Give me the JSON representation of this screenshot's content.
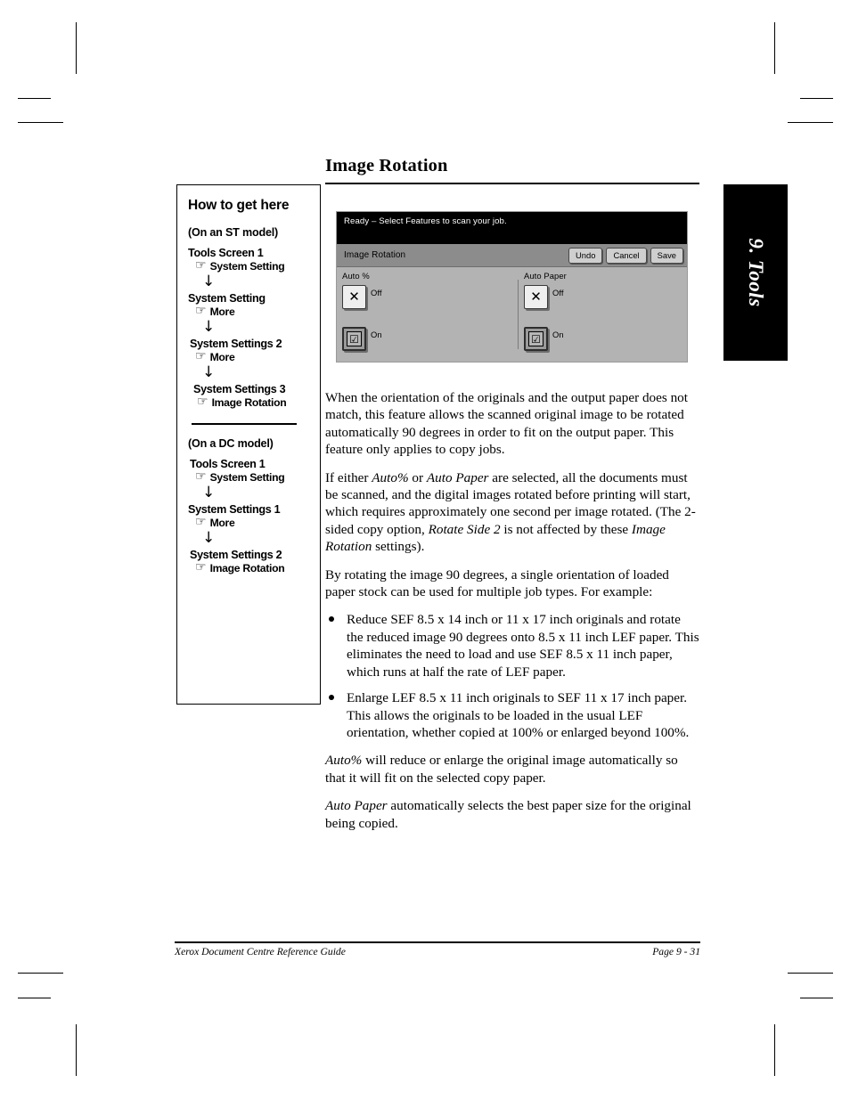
{
  "page": {
    "section_title": "Image Rotation",
    "thumb_tab_label": "9. Tools"
  },
  "howto": {
    "title": "How to get here",
    "st": {
      "model_label": "(On an ST model)",
      "steps": [
        {
          "screen": "Tools Screen 1",
          "action": "System Setting"
        },
        {
          "screen": "System Setting",
          "action": "More"
        },
        {
          "screen": "System Settings 2",
          "action": "More"
        },
        {
          "screen": "System Settings 3",
          "action": "Image Rotation"
        }
      ]
    },
    "dc": {
      "model_label": "(On a DC model)",
      "steps": [
        {
          "screen": "Tools Screen 1",
          "action": "System Setting"
        },
        {
          "screen": "System Settings 1",
          "action": "More"
        },
        {
          "screen": "System Settings 2",
          "action": "Image Rotation"
        }
      ]
    },
    "hand_icon": "☞",
    "arrow_icon": "↓"
  },
  "touchscreen": {
    "status_text": "Ready –  Select Features to scan your job.",
    "panel_title": "Image Rotation",
    "buttons": [
      {
        "label": "Undo"
      },
      {
        "label": "Cancel"
      },
      {
        "label": "Save"
      }
    ],
    "groups": [
      {
        "label": "Auto %",
        "options": [
          {
            "label": "Off",
            "glyph": "✕",
            "selected": false
          },
          {
            "label": "On",
            "glyph": "☑",
            "selected": true
          }
        ]
      },
      {
        "label": "Auto Paper",
        "options": [
          {
            "label": "Off",
            "glyph": "✕",
            "selected": false
          },
          {
            "label": "On",
            "glyph": "☑",
            "selected": true
          }
        ]
      }
    ]
  },
  "body": {
    "p1": "When the orientation of the originals and the output paper does not match, this feature allows the scanned original image to be rotated automatically 90 degrees in order to fit on the output paper. This feature only applies to copy jobs.",
    "p2_a": "If either ",
    "p2_em1": "Auto%",
    "p2_b": " or ",
    "p2_em2": "Auto Paper",
    "p2_c": " are selected, all the documents must be scanned, and the digital images rotated before printing will start, which requires approximately one second per image rotated. (The 2-sided copy option, ",
    "p2_em3": "Rotate Side 2",
    "p2_d": " is not affected by these ",
    "p2_em4": "Image Rotation",
    "p2_e": " settings).",
    "p3": "By rotating the image 90 degrees, a single orientation of loaded paper stock can be used for multiple job types. For example:",
    "bullets": [
      "Reduce SEF 8.5 x 14 inch or 11 x 17 inch originals and rotate the reduced image 90 degrees onto 8.5 x 11 inch LEF paper. This eliminates the need to load and use SEF 8.5 x 11 inch paper, which runs at half the rate of LEF paper.",
      "Enlarge LEF 8.5 x 11 inch originals to SEF 11 x 17 inch paper. This allows the originals to be loaded in the usual LEF orientation, whether copied at 100% or enlarged beyond 100%."
    ],
    "p4_em": "Auto%",
    "p4_rest": " will reduce or enlarge the original image automatically so that it will fit on the selected copy paper.",
    "p5_em": "Auto Paper",
    "p5_rest": " automatically selects the best paper size for the original being copied."
  },
  "footer": {
    "left": "Xerox Document Centre Reference Guide",
    "right": "Page 9 - 31"
  }
}
